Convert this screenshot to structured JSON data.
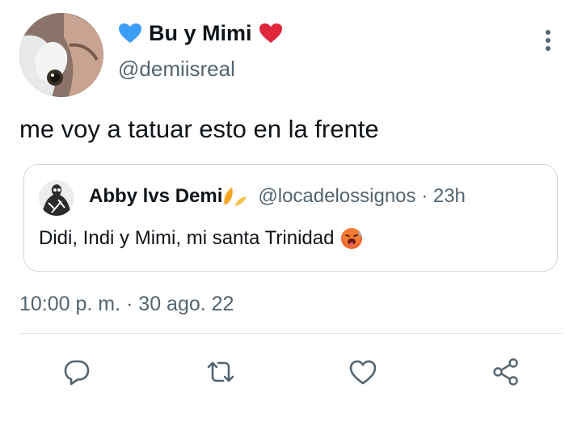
{
  "author": {
    "display_name": "Bu y Mimi",
    "handle": "@demiisreal",
    "avatar_icon": "user-avatar-photo",
    "emoji_left": "blue-heart",
    "emoji_right": "red-heart"
  },
  "tweet": {
    "text": "me voy a tatuar esto en la frente",
    "timestamp": "10:00 p. m. · 30 ago. 22"
  },
  "quote": {
    "display_name": "Abby lvs Demi",
    "name_emoji": "sunflower-petal-icons",
    "handle_time": "@locadelossignos · 23h",
    "text": "Didi, Indi y Mimi, mi santa Trinidad",
    "text_emoji": "hot-face"
  },
  "actions": [
    "reply-icon",
    "retweet-icon",
    "like-icon",
    "share-icon"
  ],
  "colors": {
    "text_primary": "#0f1419",
    "text_secondary": "#536471",
    "border": "#cfd9de",
    "heart_blue": "#3b9df5",
    "heart_red": "#e0263a"
  }
}
